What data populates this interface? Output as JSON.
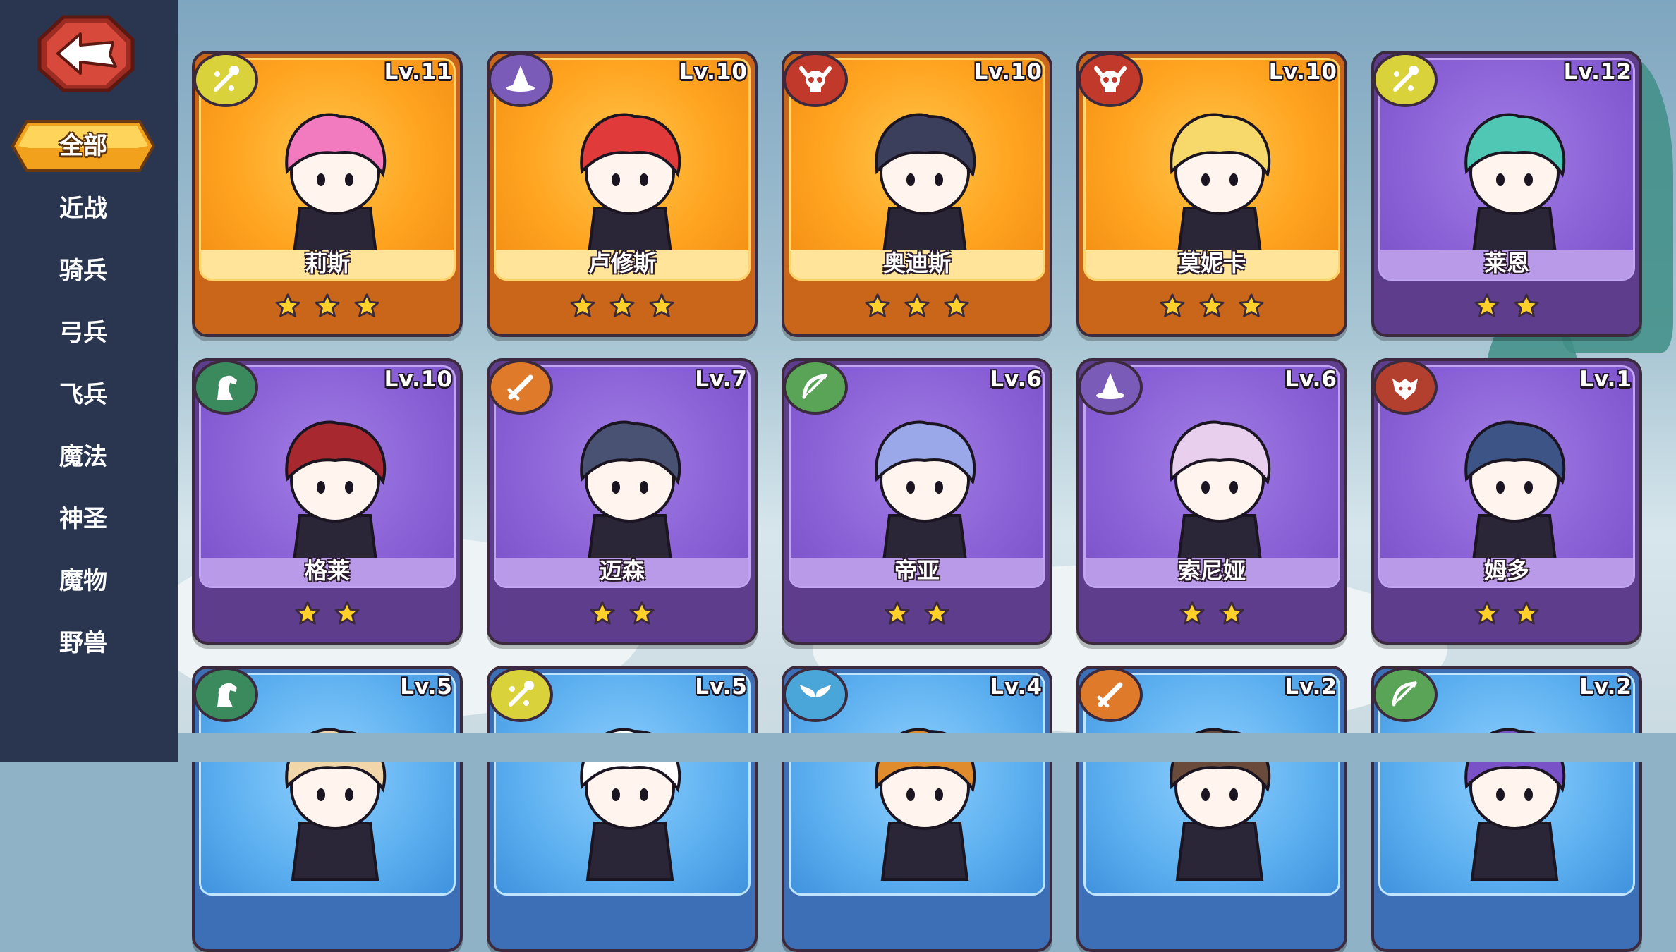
{
  "sidebar": {
    "back_icon": "back-arrow-icon",
    "selected_tab": "全部",
    "tabs": [
      "近战",
      "骑兵",
      "弓兵",
      "飞兵",
      "魔法",
      "神圣",
      "魔物",
      "野兽"
    ]
  },
  "heroes": [
    {
      "name": "莉斯",
      "level": "Lv.11",
      "class_icon": "staff-icon",
      "class_color": "#d9d23a",
      "rarity": "gold",
      "stars": 3,
      "hair": "#f27bbf"
    },
    {
      "name": "卢修斯",
      "level": "Lv.10",
      "class_icon": "wizard-hat-icon",
      "class_color": "#7b5bb8",
      "rarity": "gold",
      "stars": 3,
      "hair": "#e03a3a"
    },
    {
      "name": "奥迪斯",
      "level": "Lv.10",
      "class_icon": "skull-icon",
      "class_color": "#c0392b",
      "rarity": "gold",
      "stars": 3,
      "hair": "#3c3f5c"
    },
    {
      "name": "莫妮卡",
      "level": "Lv.10",
      "class_icon": "skull-icon",
      "class_color": "#c0392b",
      "rarity": "gold",
      "stars": 3,
      "hair": "#f7d86a"
    },
    {
      "name": "莱恩",
      "level": "Lv.12",
      "class_icon": "staff-icon",
      "class_color": "#d9d23a",
      "rarity": "purple",
      "stars": 2,
      "hair": "#4fc7b4"
    },
    {
      "name": "格莱",
      "level": "Lv.10",
      "class_icon": "horse-icon",
      "class_color": "#3a8a5e",
      "rarity": "purple",
      "stars": 2,
      "hair": "#a7282f"
    },
    {
      "name": "迈森",
      "level": "Lv.7",
      "class_icon": "sword-icon",
      "class_color": "#e07a2b",
      "rarity": "purple",
      "stars": 2,
      "hair": "#4a5273"
    },
    {
      "name": "帝亚",
      "level": "Lv.6",
      "class_icon": "bow-icon",
      "class_color": "#5aa457",
      "rarity": "purple",
      "stars": 2,
      "hair": "#9aa7e8"
    },
    {
      "name": "索尼娅",
      "level": "Lv.6",
      "class_icon": "wizard-hat-icon",
      "class_color": "#7b5bb8",
      "rarity": "purple",
      "stars": 2,
      "hair": "#e9cfee"
    },
    {
      "name": "姆多",
      "level": "Lv.1",
      "class_icon": "wolf-icon",
      "class_color": "#b3402e",
      "rarity": "purple",
      "stars": 2,
      "hair": "#3d5487"
    },
    {
      "name": "",
      "level": "Lv.5",
      "class_icon": "horse-icon",
      "class_color": "#3a8a5e",
      "rarity": "blue",
      "stars": 0,
      "hair": "#f0d6a8"
    },
    {
      "name": "",
      "level": "Lv.5",
      "class_icon": "staff-icon",
      "class_color": "#d9d23a",
      "rarity": "blue",
      "stars": 0,
      "hair": "#ffffff"
    },
    {
      "name": "",
      "level": "Lv.4",
      "class_icon": "wings-icon",
      "class_color": "#4aa6d9",
      "rarity": "blue",
      "stars": 0,
      "hair": "#e08b2c"
    },
    {
      "name": "",
      "level": "Lv.2",
      "class_icon": "sword-icon",
      "class_color": "#e07a2b",
      "rarity": "blue",
      "stars": 0,
      "hair": "#6a4a3a"
    },
    {
      "name": "",
      "level": "Lv.2",
      "class_icon": "bow-icon",
      "class_color": "#5aa457",
      "rarity": "blue",
      "stars": 0,
      "hair": "#7a52c7"
    }
  ]
}
